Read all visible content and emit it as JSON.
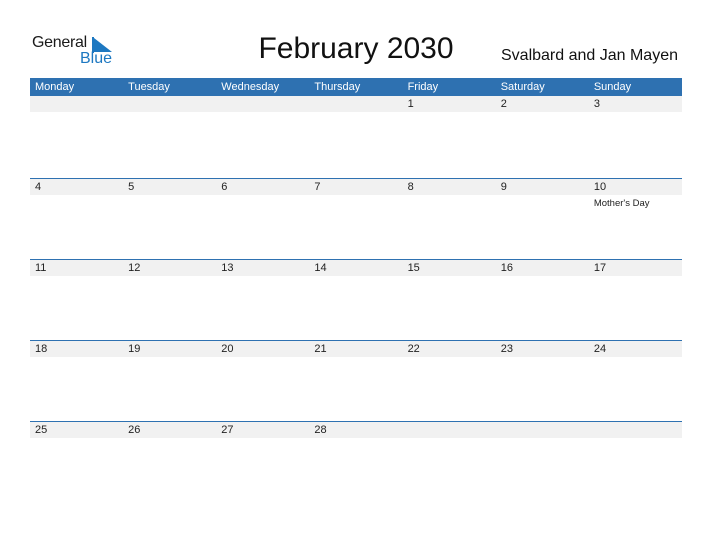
{
  "logo": {
    "word1": "General",
    "word2": "Blue"
  },
  "title": "February 2030",
  "region": "Svalbard and Jan Mayen",
  "days": [
    "Monday",
    "Tuesday",
    "Wednesday",
    "Thursday",
    "Friday",
    "Saturday",
    "Sunday"
  ],
  "weeks": [
    [
      "",
      "",
      "",
      "",
      "1",
      "2",
      "3"
    ],
    [
      "4",
      "5",
      "6",
      "7",
      "8",
      "9",
      "10"
    ],
    [
      "11",
      "12",
      "13",
      "14",
      "15",
      "16",
      "17"
    ],
    [
      "18",
      "19",
      "20",
      "21",
      "22",
      "23",
      "24"
    ],
    [
      "25",
      "26",
      "27",
      "28",
      "",
      "",
      ""
    ]
  ],
  "events": {
    "1-6": "Mother's Day"
  },
  "colors": {
    "accent": "#2e71b1",
    "logo_blue": "#1d78c1",
    "strip": "#f1f1f1"
  }
}
